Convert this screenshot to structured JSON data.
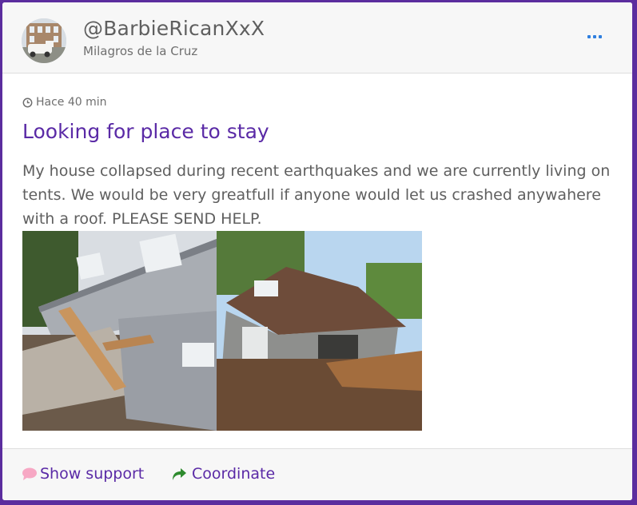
{
  "post": {
    "handle": "@BarbieRicanXxX",
    "author_name": "Milagros de la Cruz",
    "time_ago": "Hace 40 min",
    "title": "Looking for place to stay",
    "body": "My house collapsed during recent earthquakes and we are currently living on tents. We would be very greatfull if anyone would let us crashed anywahere with a roof. PLEASE SEND HELP."
  },
  "actions": {
    "show_support": "Show support",
    "coordinate": "Coordinate"
  },
  "icons": {
    "more": "ellipsis-icon",
    "time": "clock-icon",
    "support": "speech-bubble-icon",
    "coordinate": "share-arrow-icon"
  },
  "colors": {
    "background": "#5b2d9e",
    "title": "#5a2aa6",
    "more_dots": "#2f7fdf",
    "support_icon": "#f7a8c4",
    "coordinate_icon": "#2e8b2e"
  }
}
